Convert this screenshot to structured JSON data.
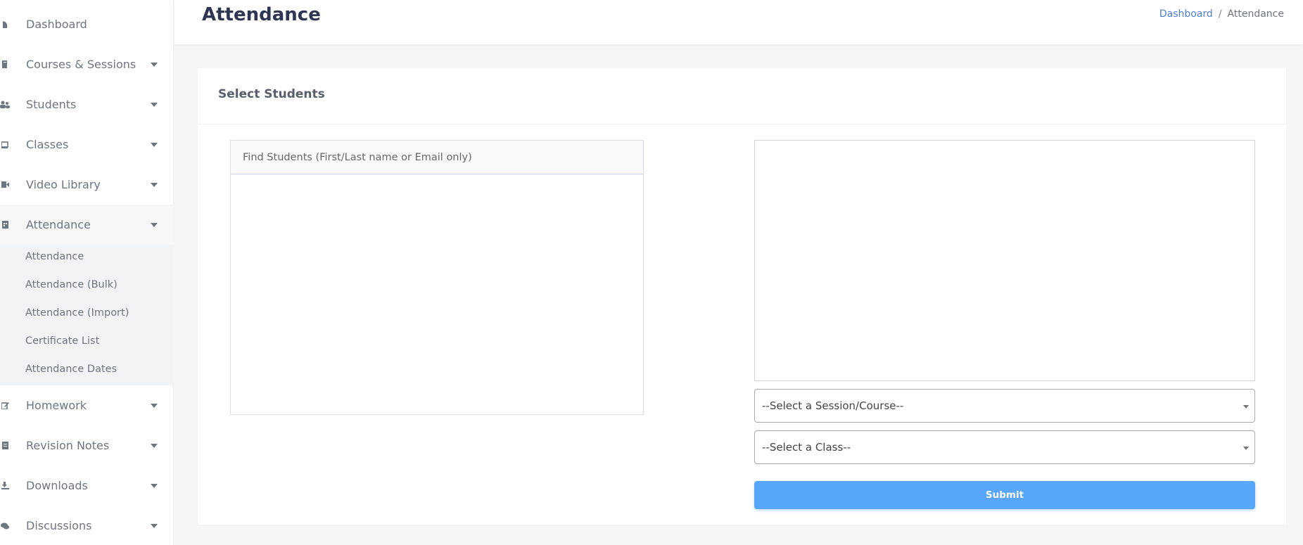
{
  "sidebar": {
    "items": [
      {
        "label": "Dashboard",
        "icon": "dashboard-icon"
      },
      {
        "label": "Courses & Sessions",
        "icon": "book-icon"
      },
      {
        "label": "Students",
        "icon": "users-icon"
      },
      {
        "label": "Classes",
        "icon": "chalkboard-icon"
      },
      {
        "label": "Video Library",
        "icon": "video-icon"
      },
      {
        "label": "Attendance",
        "icon": "calendar-icon"
      },
      {
        "label": "Homework",
        "icon": "edit-icon"
      },
      {
        "label": "Revision Notes",
        "icon": "notes-icon"
      },
      {
        "label": "Downloads",
        "icon": "download-icon"
      },
      {
        "label": "Discussions",
        "icon": "comments-icon"
      }
    ],
    "submenu": [
      {
        "label": "Attendance"
      },
      {
        "label": "Attendance (Bulk)"
      },
      {
        "label": "Attendance (Import)"
      },
      {
        "label": "Certificate List"
      },
      {
        "label": "Attendance Dates"
      }
    ]
  },
  "header": {
    "title": "Attendance",
    "breadcrumb": {
      "home": "Dashboard",
      "separator": "/",
      "current": "Attendance"
    }
  },
  "card": {
    "title": "Select Students",
    "find_placeholder": "Find Students (First/Last name or Email only)",
    "session_select": "--Select a Session/Course--",
    "class_select": "--Select a Class--",
    "submit_label": "Submit"
  },
  "colors": {
    "accent": "#57a6f9",
    "link": "#4e7fd6",
    "title": "#2e3452"
  }
}
